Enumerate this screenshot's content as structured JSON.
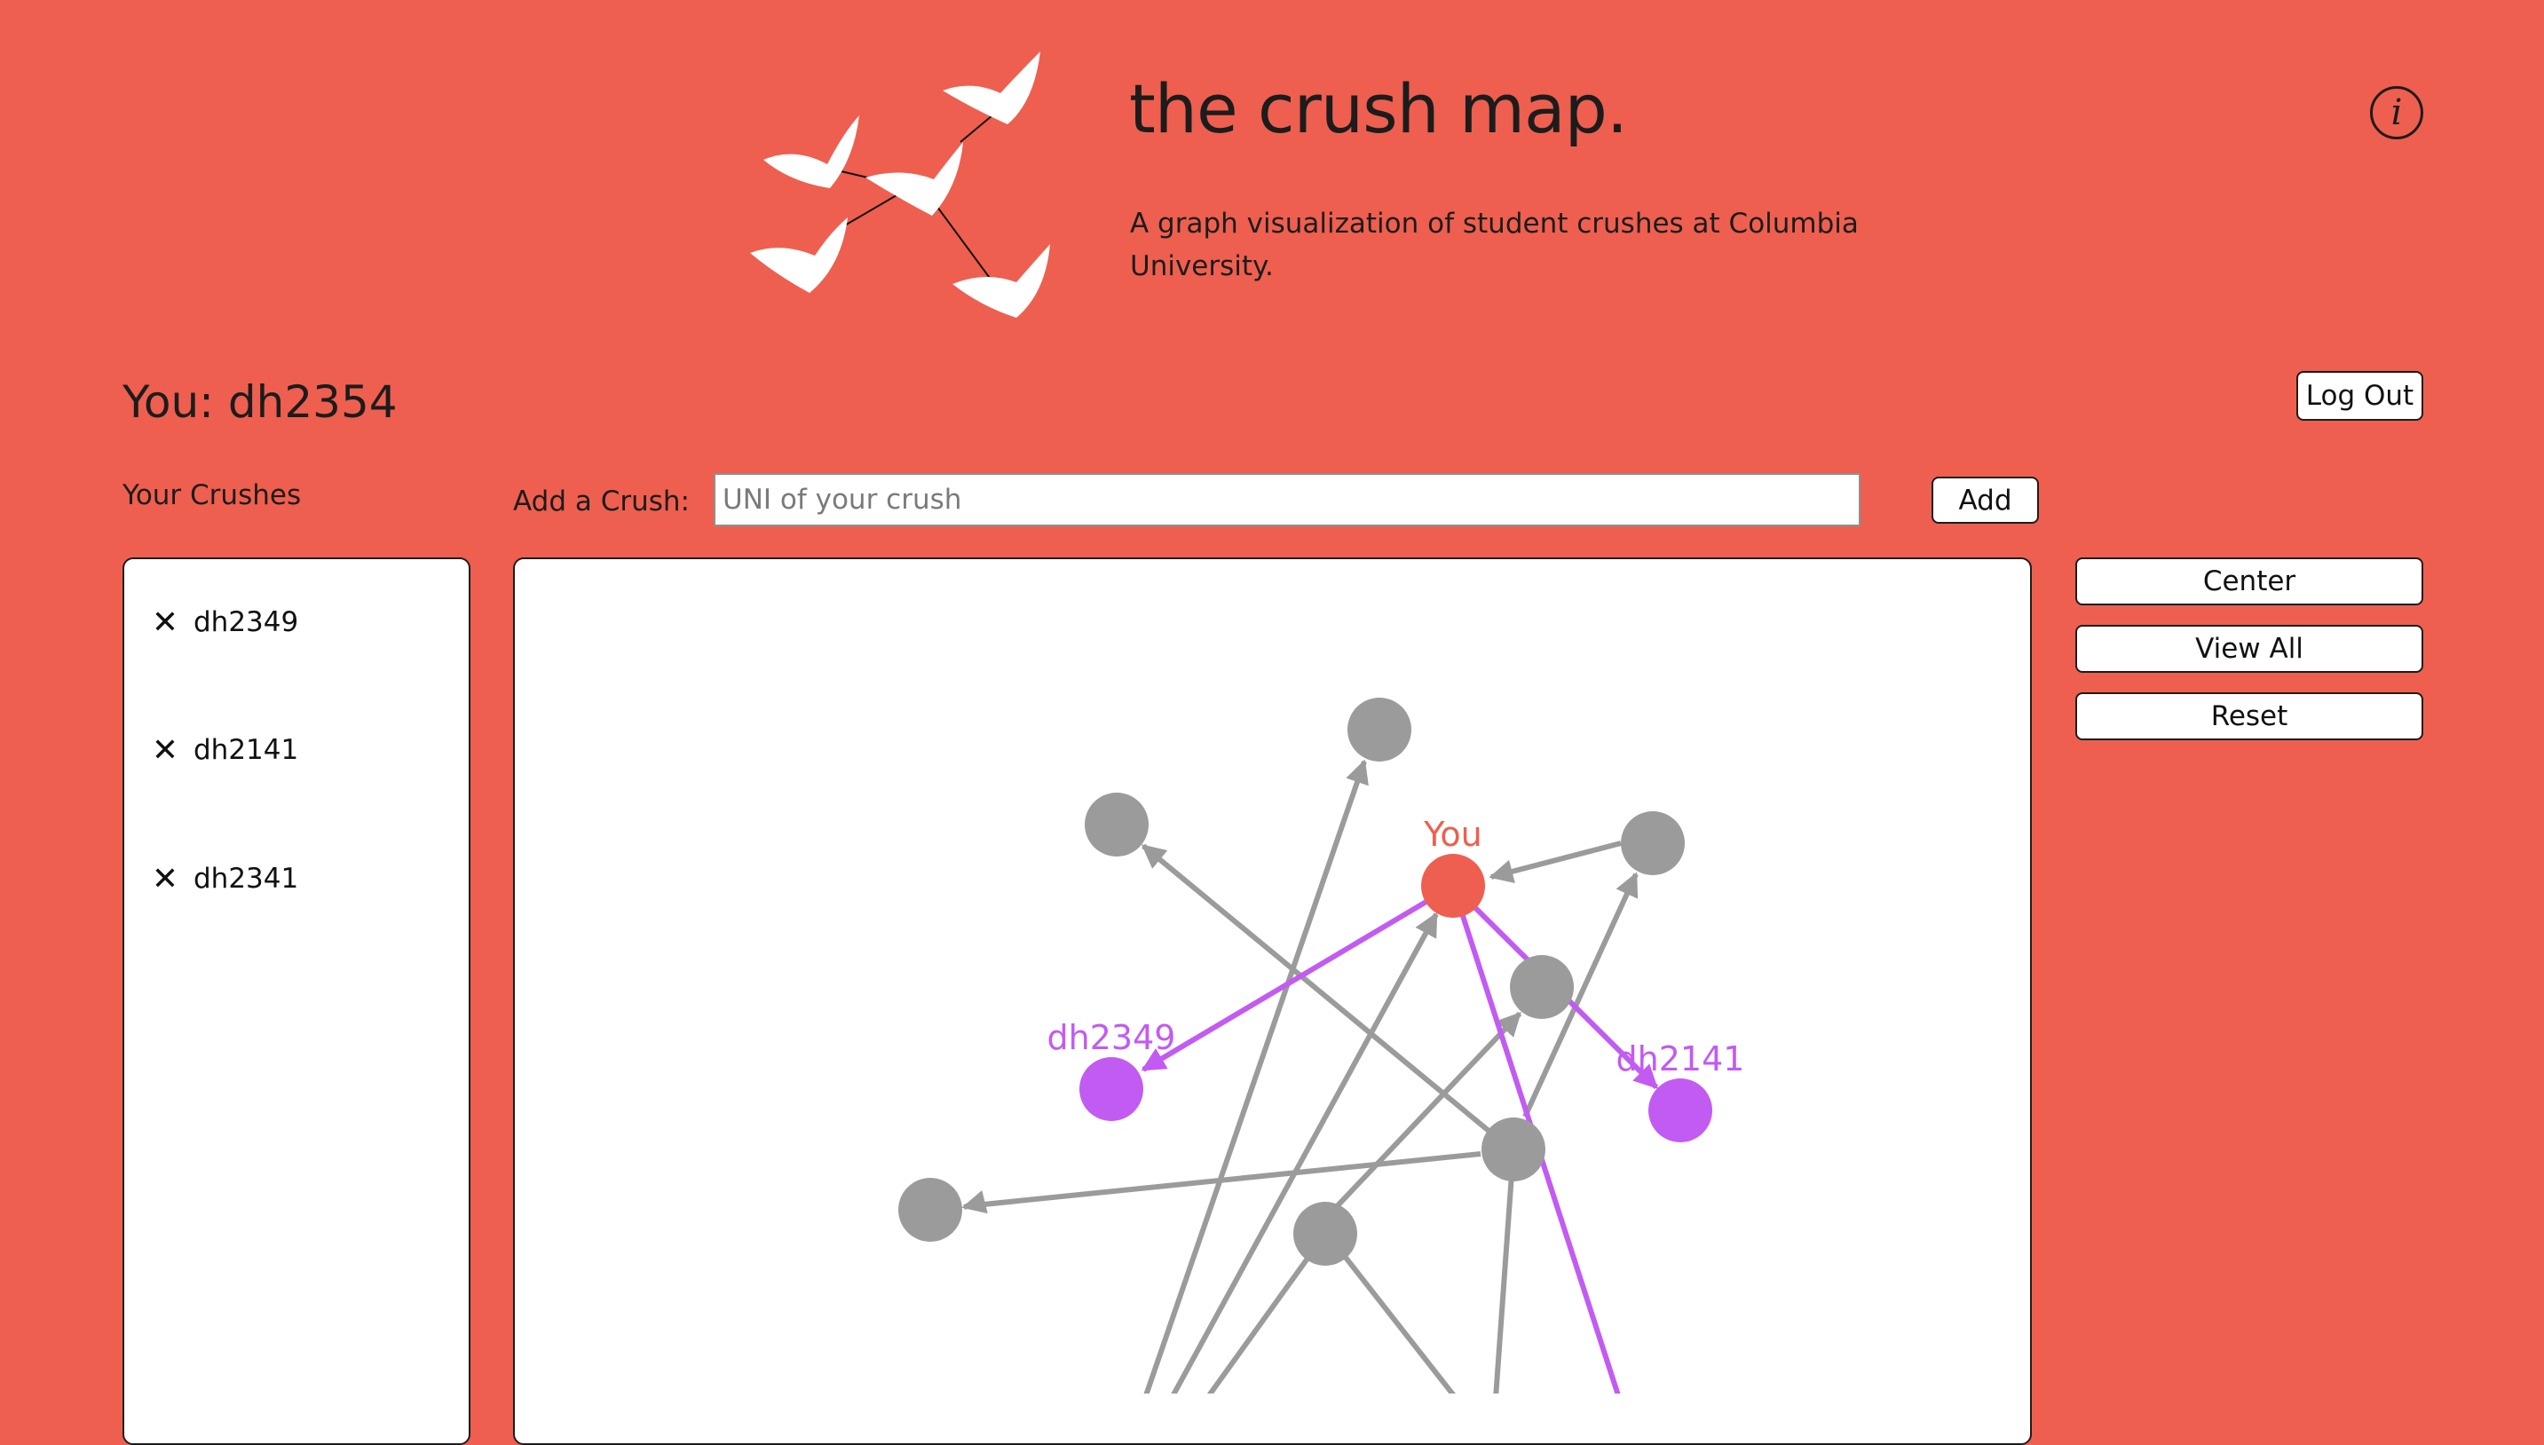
{
  "header": {
    "title": "the crush map.",
    "subtitle": "A graph visualization of student crushes at Columbia University.",
    "info_icon": "info-icon"
  },
  "user": {
    "label": "You: dh2354"
  },
  "actions": {
    "logout_label": "Log Out"
  },
  "crushes": {
    "heading": "Your Crushes",
    "remove_icon": "close-icon",
    "items": [
      {
        "uni": "dh2349"
      },
      {
        "uni": "dh2141"
      },
      {
        "uni": "dh2341"
      }
    ]
  },
  "add_crush": {
    "label": "Add a Crush:",
    "placeholder": "UNI of your crush",
    "value": "",
    "button_label": "Add"
  },
  "controls": {
    "center_label": "Center",
    "view_all_label": "View All",
    "reset_label": "Reset"
  },
  "graph": {
    "you_label": "You",
    "crush_labels": [
      "dh2349",
      "dh2141"
    ],
    "colors": {
      "self": "#ee5f4f",
      "crush": "#c25bf2",
      "other": "#9b9b9b",
      "background": "#ee5f4f"
    }
  }
}
